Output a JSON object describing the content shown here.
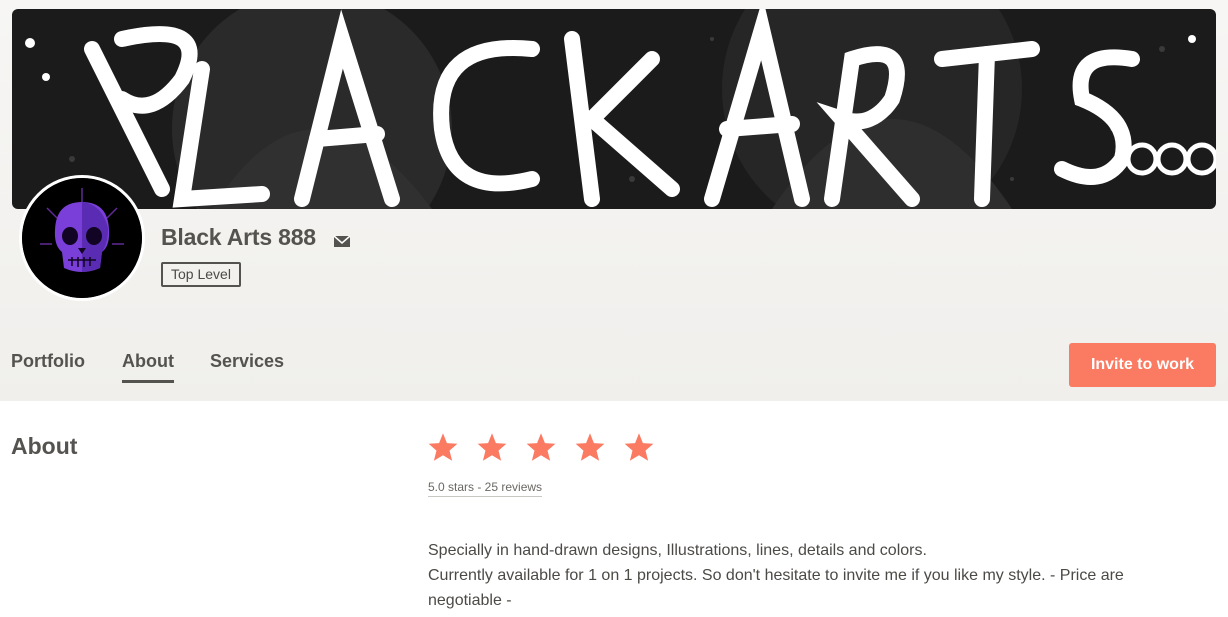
{
  "profile": {
    "name": "Black Arts 888",
    "level_badge": "Top Level",
    "banner_text": "BLACK ARTS 888"
  },
  "tabs": [
    {
      "label": "Portfolio",
      "active": false
    },
    {
      "label": "About",
      "active": true
    },
    {
      "label": "Services",
      "active": false
    }
  ],
  "actions": {
    "invite_label": "Invite to work"
  },
  "about": {
    "title": "About",
    "rating_value": 5,
    "rating_max": 5,
    "rating_text": "5.0 stars - 25 reviews",
    "bio_line1": "Specially in hand-drawn designs, Illustrations, lines, details and colors.",
    "bio_line2": "Currently available for 1 on 1 projects. So don't hesitate to invite me if you like my style. - Price are negotiable -"
  },
  "icons": [
    "mail-icon",
    "star-icon"
  ],
  "colors": {
    "accent": "#fa7a62",
    "text": "#55534f",
    "banner_bg": "#1b1b1b"
  }
}
